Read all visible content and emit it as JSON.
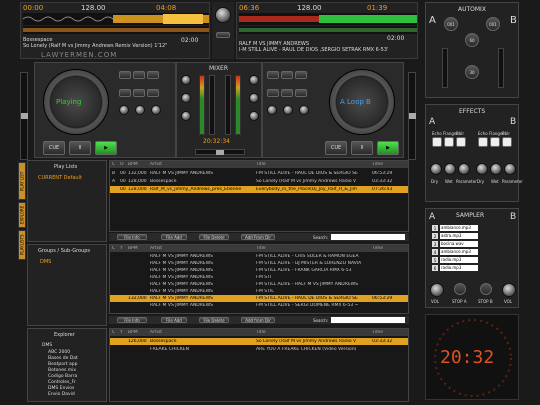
{
  "deck_left": {
    "time_elapsed": "00:00",
    "time_remain": "04:08",
    "bpm": "128.00",
    "time_total": "02:00",
    "artist": "Bossespace",
    "title": "So Lonely (Ralf M vs Jimmy Andrews Remix Version) 1'12\"",
    "brand": "LAWYERMEN.COM",
    "pitch_label": "Playing",
    "cue_label": "CUE",
    "pause_label": "II",
    "play_label": "▶"
  },
  "deck_right": {
    "time_elapsed": "06:36",
    "time_remain": "01:39",
    "bpm": "128.00",
    "time_total": "02:00",
    "artist": "RALF M VS JIMMY ANDREWS",
    "title": "I-M STILL ALIVE - RAUL DE DIOS ,SERGIO SETRAK RMX 6-53'",
    "loop_label": "A Loop B",
    "cue_label": "CUE",
    "pause_label": "II",
    "play_label": "▶"
  },
  "mixer": {
    "title": "MIXER",
    "clock": "20:32:34"
  },
  "automix": {
    "title": "AUTOMIX",
    "ch_a": "A",
    "ch_b": "B",
    "ch_label": "Ch",
    "values": [
      "001",
      "001",
      "60",
      "30"
    ]
  },
  "effects": {
    "title": "EFFECTS",
    "ch_a": "A",
    "ch_b": "B",
    "labels_left": [
      "Echo",
      "Flanger",
      "Bblr"
    ],
    "labels_right": [
      "Echo",
      "Flanger",
      "Bblr"
    ],
    "knob_labels": [
      "Dry",
      "Wet",
      "Parameter",
      "Dry",
      "Wet",
      "Parameter"
    ]
  },
  "sampler": {
    "title": "SAMPLER",
    "ch_a": "A",
    "ch_b": "B",
    "items": [
      "ambiance.mp3",
      "astra.mp3",
      "bocina.wav",
      "ambiance.mp3",
      "radio.mp3",
      "radio.mp3"
    ],
    "vol_label": "VOL",
    "stop_a": "STOP A",
    "stop_b": "STOP B"
  },
  "big_clock": "20:32",
  "sidebar": {
    "tabs": [
      "PLAYLISTS",
      "EXPLORE",
      "PLAY LIST"
    ],
    "playlists_header": "Play Lists",
    "playlist_item": "CURRENT Default",
    "groups_header": "Groups / Sub-Groups",
    "group_item": "DMS",
    "explorer_header": "Explorer",
    "tree": [
      "DMS",
      "ABC 2000",
      "Bases de Dat",
      "Beatport app",
      "Botones mix",
      "Codigo Barra",
      "Controles_Fr",
      "DMS Envios",
      "Envio David"
    ]
  },
  "top_list": {
    "headers": [
      "C",
      "O",
      "BPM",
      "Artist",
      "Title",
      "Time"
    ],
    "rows": [
      [
        "B",
        "0001",
        "132,000",
        "RALF M VS JIMMY ANDREWS",
        "I-M STILL ALIVE - RAUL DE DIOS & SERGIO SE",
        "06:53:29"
      ],
      [
        "A",
        "0002",
        "128,000",
        "Bossespace",
        "So Lonely (Ralf M vs Jimmy Andrews Radio V",
        "03:33:32"
      ],
      [
        "",
        "0006",
        "128,000",
        "Ralf_M_vs_Jimmy_Andrews_pres_Etienne",
        "Everybody_in_the_Place(Dj_Joy_Ralf_H_&_Jim",
        "07:26:43"
      ]
    ],
    "buttons": [
      "File Info",
      "File Add",
      "File Delete",
      "Add From Dir"
    ],
    "search_label": "Search:"
  },
  "middle_list": {
    "headers": [
      "C",
      "Y",
      "BPM",
      "Artist",
      "Title",
      "Time"
    ],
    "rows": [
      [
        "",
        "",
        "",
        "RALF M VS JIMMY ANDREWS",
        "I-M STILL ALIVE - CRIS SOLER & RAMON EGEA",
        ""
      ],
      [
        "",
        "",
        "",
        "RALF M VS JIMMY ANDREWS",
        "I-M STILL ALIVE - DJ MISTER & LORENZO NAVIA",
        ""
      ],
      [
        "",
        "",
        "",
        "RALF M VS JIMMY ANDREWS",
        "I-M STILL ALIVE - FRANK GARCIA RMX 6-53",
        ""
      ],
      [
        "",
        "",
        "",
        "RALF M VS JIMMY ANDREWS",
        "I-M STI",
        ""
      ],
      [
        "",
        "",
        "",
        "RALF M VS JIMMY ANDREWS",
        "I-M STILL ALIVE - RALF M VS JIMMY ANDREWS",
        ""
      ],
      [
        "",
        "",
        "",
        "RALF M VS JIMMY ANDREWS",
        "I-M STIL",
        ""
      ],
      [
        "",
        "",
        "132,000",
        "RALF M VS JIMMY ANDREWS",
        "I-M STILL ALIVE - RAUL DE DIOS & SERGIO SE",
        "06:53:29"
      ],
      [
        "",
        "",
        "",
        "RALF M VS JIMMY ANDREWS",
        "I-M STILL ALIVE - SERGI DOMENE RMX 6-53 ~",
        ""
      ]
    ],
    "buttons": [
      "File Info",
      "File Add",
      "File Delete",
      "Add from Dir"
    ],
    "search_label": "Search:"
  },
  "bottom_list": {
    "headers": [
      "C",
      "Y",
      "BPM",
      "Artist",
      "Title",
      "Time"
    ],
    "rows": [
      [
        "",
        "",
        "126,000",
        "Bossespace",
        "So Lonely (Ralf M vs Jimmy Andrews Radio V",
        "03:33:32"
      ],
      [
        "",
        "",
        "",
        "FREAKE CHICKEN",
        "ARE YOU A FREAKE CHICKEN (Video Version)",
        ""
      ]
    ]
  },
  "colors": {
    "accent": "#e0a020",
    "clock": "#e05020",
    "play_green": "#30c030",
    "wave_left": "#e0a020",
    "wave_right": "#30c040"
  }
}
